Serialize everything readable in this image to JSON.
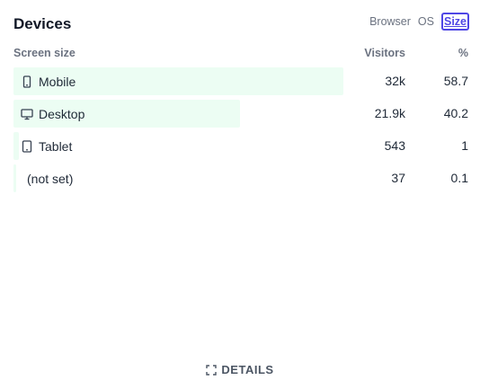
{
  "panel": {
    "title": "Devices",
    "tabs": [
      {
        "label": "Browser",
        "active": false
      },
      {
        "label": "OS",
        "active": false
      },
      {
        "label": "Size",
        "active": true
      }
    ]
  },
  "table": {
    "columns": {
      "label": "Screen size",
      "visitors": "Visitors",
      "percent": "%"
    },
    "rows": [
      {
        "label": "Mobile",
        "icon": "mobile-icon",
        "visitors": "32k",
        "percent": "58.7",
        "share": 0.587
      },
      {
        "label": "Desktop",
        "icon": "desktop-icon",
        "visitors": "21.9k",
        "percent": "40.2",
        "share": 0.402
      },
      {
        "label": "Tablet",
        "icon": "tablet-icon",
        "visitors": "543",
        "percent": "1",
        "share": 0.01
      },
      {
        "label": "(not set)",
        "icon": "",
        "visitors": "37",
        "percent": "0.1",
        "share": 0.001
      }
    ]
  },
  "footer": {
    "details_label": "DETAILS",
    "details_icon": "expand-icon"
  },
  "colors": {
    "accent": "#4f46e5",
    "bar": "#ecfdf3"
  }
}
